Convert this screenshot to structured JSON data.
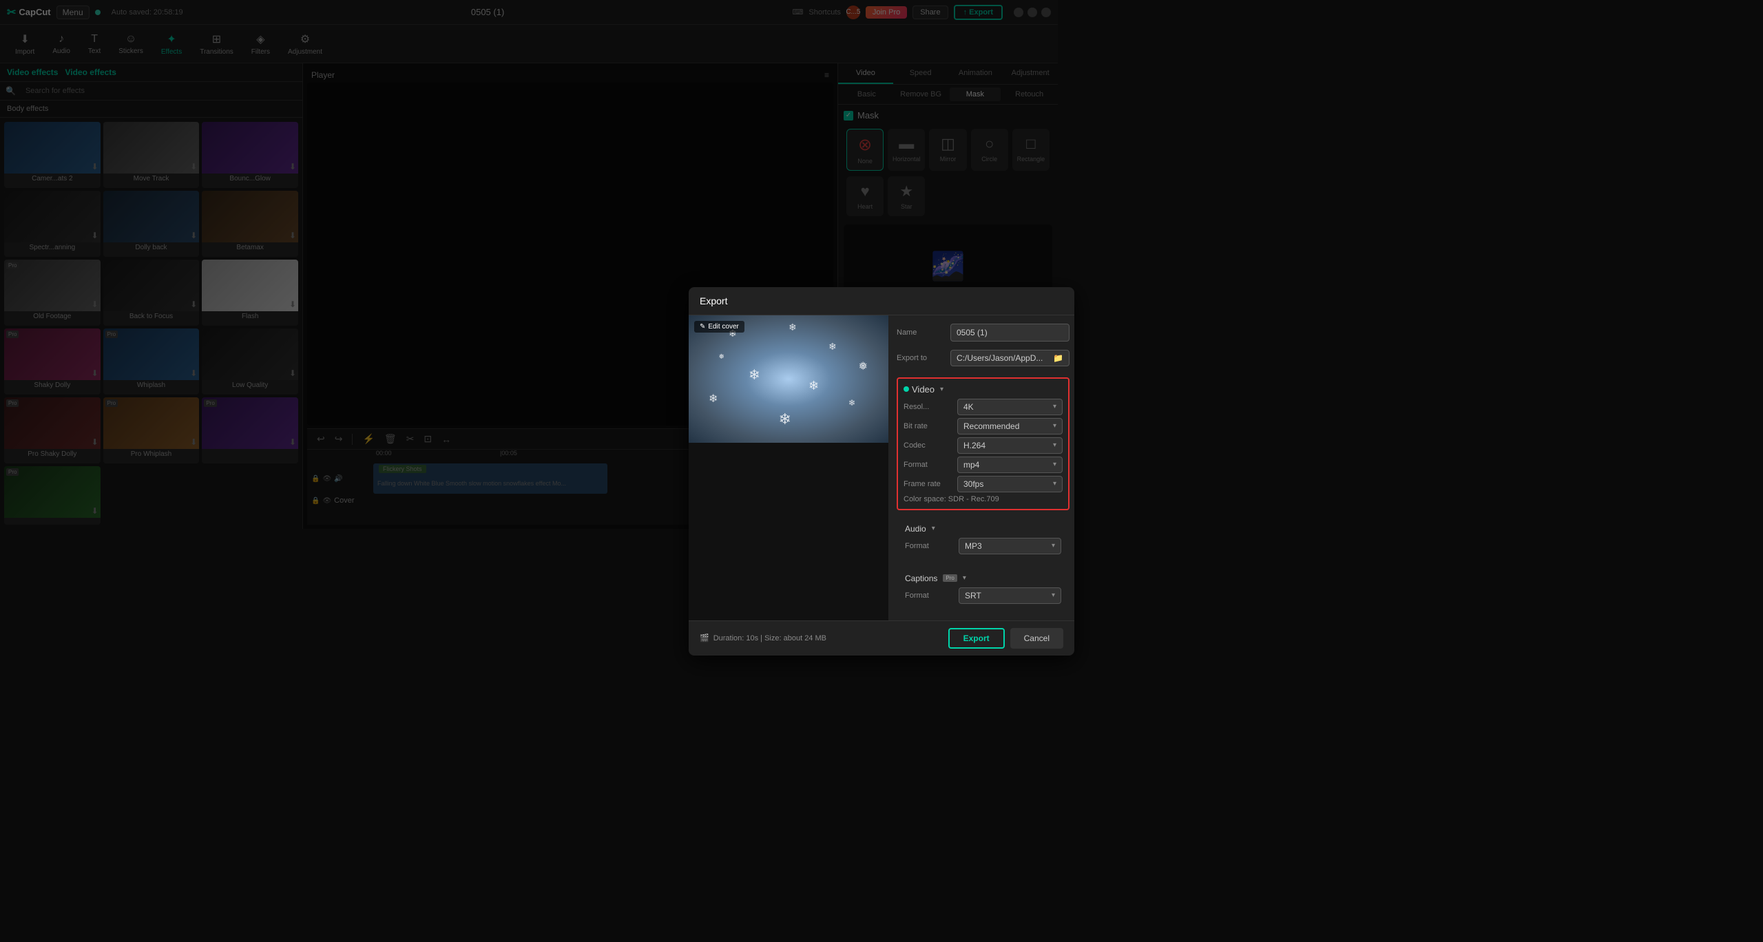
{
  "app": {
    "name": "CapCut",
    "menu_label": "Menu",
    "autosave": "Auto saved: 20:58:19",
    "title": "0505 (1)",
    "window_controls": [
      "minimize",
      "maximize",
      "close"
    ]
  },
  "top_bar": {
    "shortcuts_label": "Shortcuts",
    "user_label": "C...5",
    "join_pro_label": "Join Pro",
    "share_label": "Share",
    "export_label": "Export"
  },
  "toolbar": {
    "items": [
      {
        "label": "Import",
        "icon": "⬇"
      },
      {
        "label": "Audio",
        "icon": "♪"
      },
      {
        "label": "Text",
        "icon": "T"
      },
      {
        "label": "Stickers",
        "icon": "☺"
      },
      {
        "label": "Effects",
        "icon": "✦"
      },
      {
        "label": "Transitions",
        "icon": "⊞"
      },
      {
        "label": "Filters",
        "icon": "◈"
      },
      {
        "label": "Adjustment",
        "icon": "⚙"
      }
    ],
    "active": "Effects"
  },
  "left_panel": {
    "effects_title": "Video effects",
    "search_placeholder": "Search for effects",
    "body_effects": "Body effects",
    "effects": [
      {
        "name": "Camer...ats 2",
        "thumb": "blue",
        "pro": false
      },
      {
        "name": "Move Track",
        "thumb": "gray",
        "pro": false
      },
      {
        "name": "Bounc...Glow",
        "thumb": "purple",
        "pro": false
      },
      {
        "name": "Spectr...anning",
        "thumb": "dark",
        "pro": false
      },
      {
        "name": "Dolly back",
        "thumb": "city",
        "pro": false
      },
      {
        "name": "Betamax",
        "thumb": "warm",
        "pro": false
      },
      {
        "name": "Old Footage",
        "thumb": "gray",
        "pro": true
      },
      {
        "name": "Back to Focus",
        "thumb": "dark",
        "pro": false
      },
      {
        "name": "Flash",
        "thumb": "light",
        "pro": false
      },
      {
        "name": "Shaky Dolly",
        "thumb": "pink",
        "pro": true
      },
      {
        "name": "Whiplash",
        "thumb": "blue",
        "pro": true
      },
      {
        "name": "Low Quality",
        "thumb": "dark",
        "pro": false
      },
      {
        "name": "Pro Shaky Dolly",
        "thumb": "red",
        "pro": true
      },
      {
        "name": "Pro Whiplash",
        "thumb": "orange",
        "pro": true
      },
      {
        "name": "",
        "thumb": "purple",
        "pro": true
      },
      {
        "name": "",
        "thumb": "green",
        "pro": true
      }
    ]
  },
  "player": {
    "label": "Player"
  },
  "right_panel": {
    "tabs": [
      "Video",
      "Speed",
      "Animation",
      "Adjustment"
    ],
    "active_tab": "Video",
    "subtabs": [
      "Basic",
      "Remove BG",
      "Mask",
      "Retouch"
    ],
    "active_subtab": "Mask",
    "mask_label": "Mask",
    "shapes": [
      {
        "label": "None",
        "icon": "⊗",
        "active": true
      },
      {
        "label": "Horizontal",
        "icon": "▭",
        "active": false
      },
      {
        "label": "Mirror",
        "icon": "◫",
        "active": false
      },
      {
        "label": "Circle",
        "icon": "○",
        "active": false
      },
      {
        "label": "Rectangle",
        "icon": "□",
        "active": false
      },
      {
        "label": "Heart",
        "icon": "♥",
        "active": false
      },
      {
        "label": "Star",
        "icon": "★",
        "active": false
      }
    ]
  },
  "modal": {
    "title": "Export",
    "edit_cover_label": "Edit cover",
    "name_label": "Name",
    "name_value": "0505 (1)",
    "export_to_label": "Export to",
    "export_to_value": "C:/Users/Jason/AppD...",
    "video_section_label": "Video",
    "resolution_label": "Resol...",
    "resolution_value": "4K",
    "bitrate_label": "Bit rate",
    "bitrate_value": "Recommended",
    "codec_label": "Codec",
    "codec_value": "H.264",
    "format_label": "Format",
    "format_value": "mp4",
    "frame_rate_label": "Frame rate",
    "frame_rate_value": "30fps",
    "color_space_label": "Color space: SDR - Rec.709",
    "audio_section_label": "Audio",
    "audio_format_label": "Format",
    "audio_format_value": "MP3",
    "captions_section_label": "Captions",
    "captions_format_label": "Format",
    "captions_format_value": "SRT",
    "duration_info": "Duration: 10s | Size: about 24 MB",
    "export_button": "Export",
    "cancel_button": "Cancel"
  },
  "timeline": {
    "track_label": "Cover",
    "clip_title": "Flickery Shots",
    "clip_text": "Falling down White Blue Smooth slow motion snowflakes effect Mo..."
  }
}
